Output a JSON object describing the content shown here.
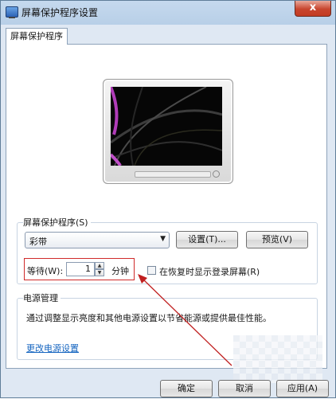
{
  "window": {
    "title": "屏幕保护程序设置",
    "close_symbol": "x",
    "title_icon": "display-icon"
  },
  "tabs": [
    {
      "label": "屏幕保护程序"
    }
  ],
  "screensaver": {
    "group_label": "屏幕保护程序(S)",
    "selected": "彩带",
    "settings_button": "设置(T)...",
    "preview_button": "预览(V)",
    "wait_label": "等待(W):",
    "wait_value": "1",
    "wait_unit": "分钟",
    "resume_checkbox_label": "在恢复时显示登录屏幕(R)",
    "resume_checked": false
  },
  "power": {
    "group_label": "电源管理",
    "description": "通过调整显示亮度和其他电源设置以节省能源或提供最佳性能。",
    "link": "更改电源设置"
  },
  "footer": {
    "ok": "确定",
    "cancel": "取消",
    "apply": "应用(A)"
  },
  "colors": {
    "highlight_box": "#d02a2a",
    "link": "#1565c0"
  }
}
